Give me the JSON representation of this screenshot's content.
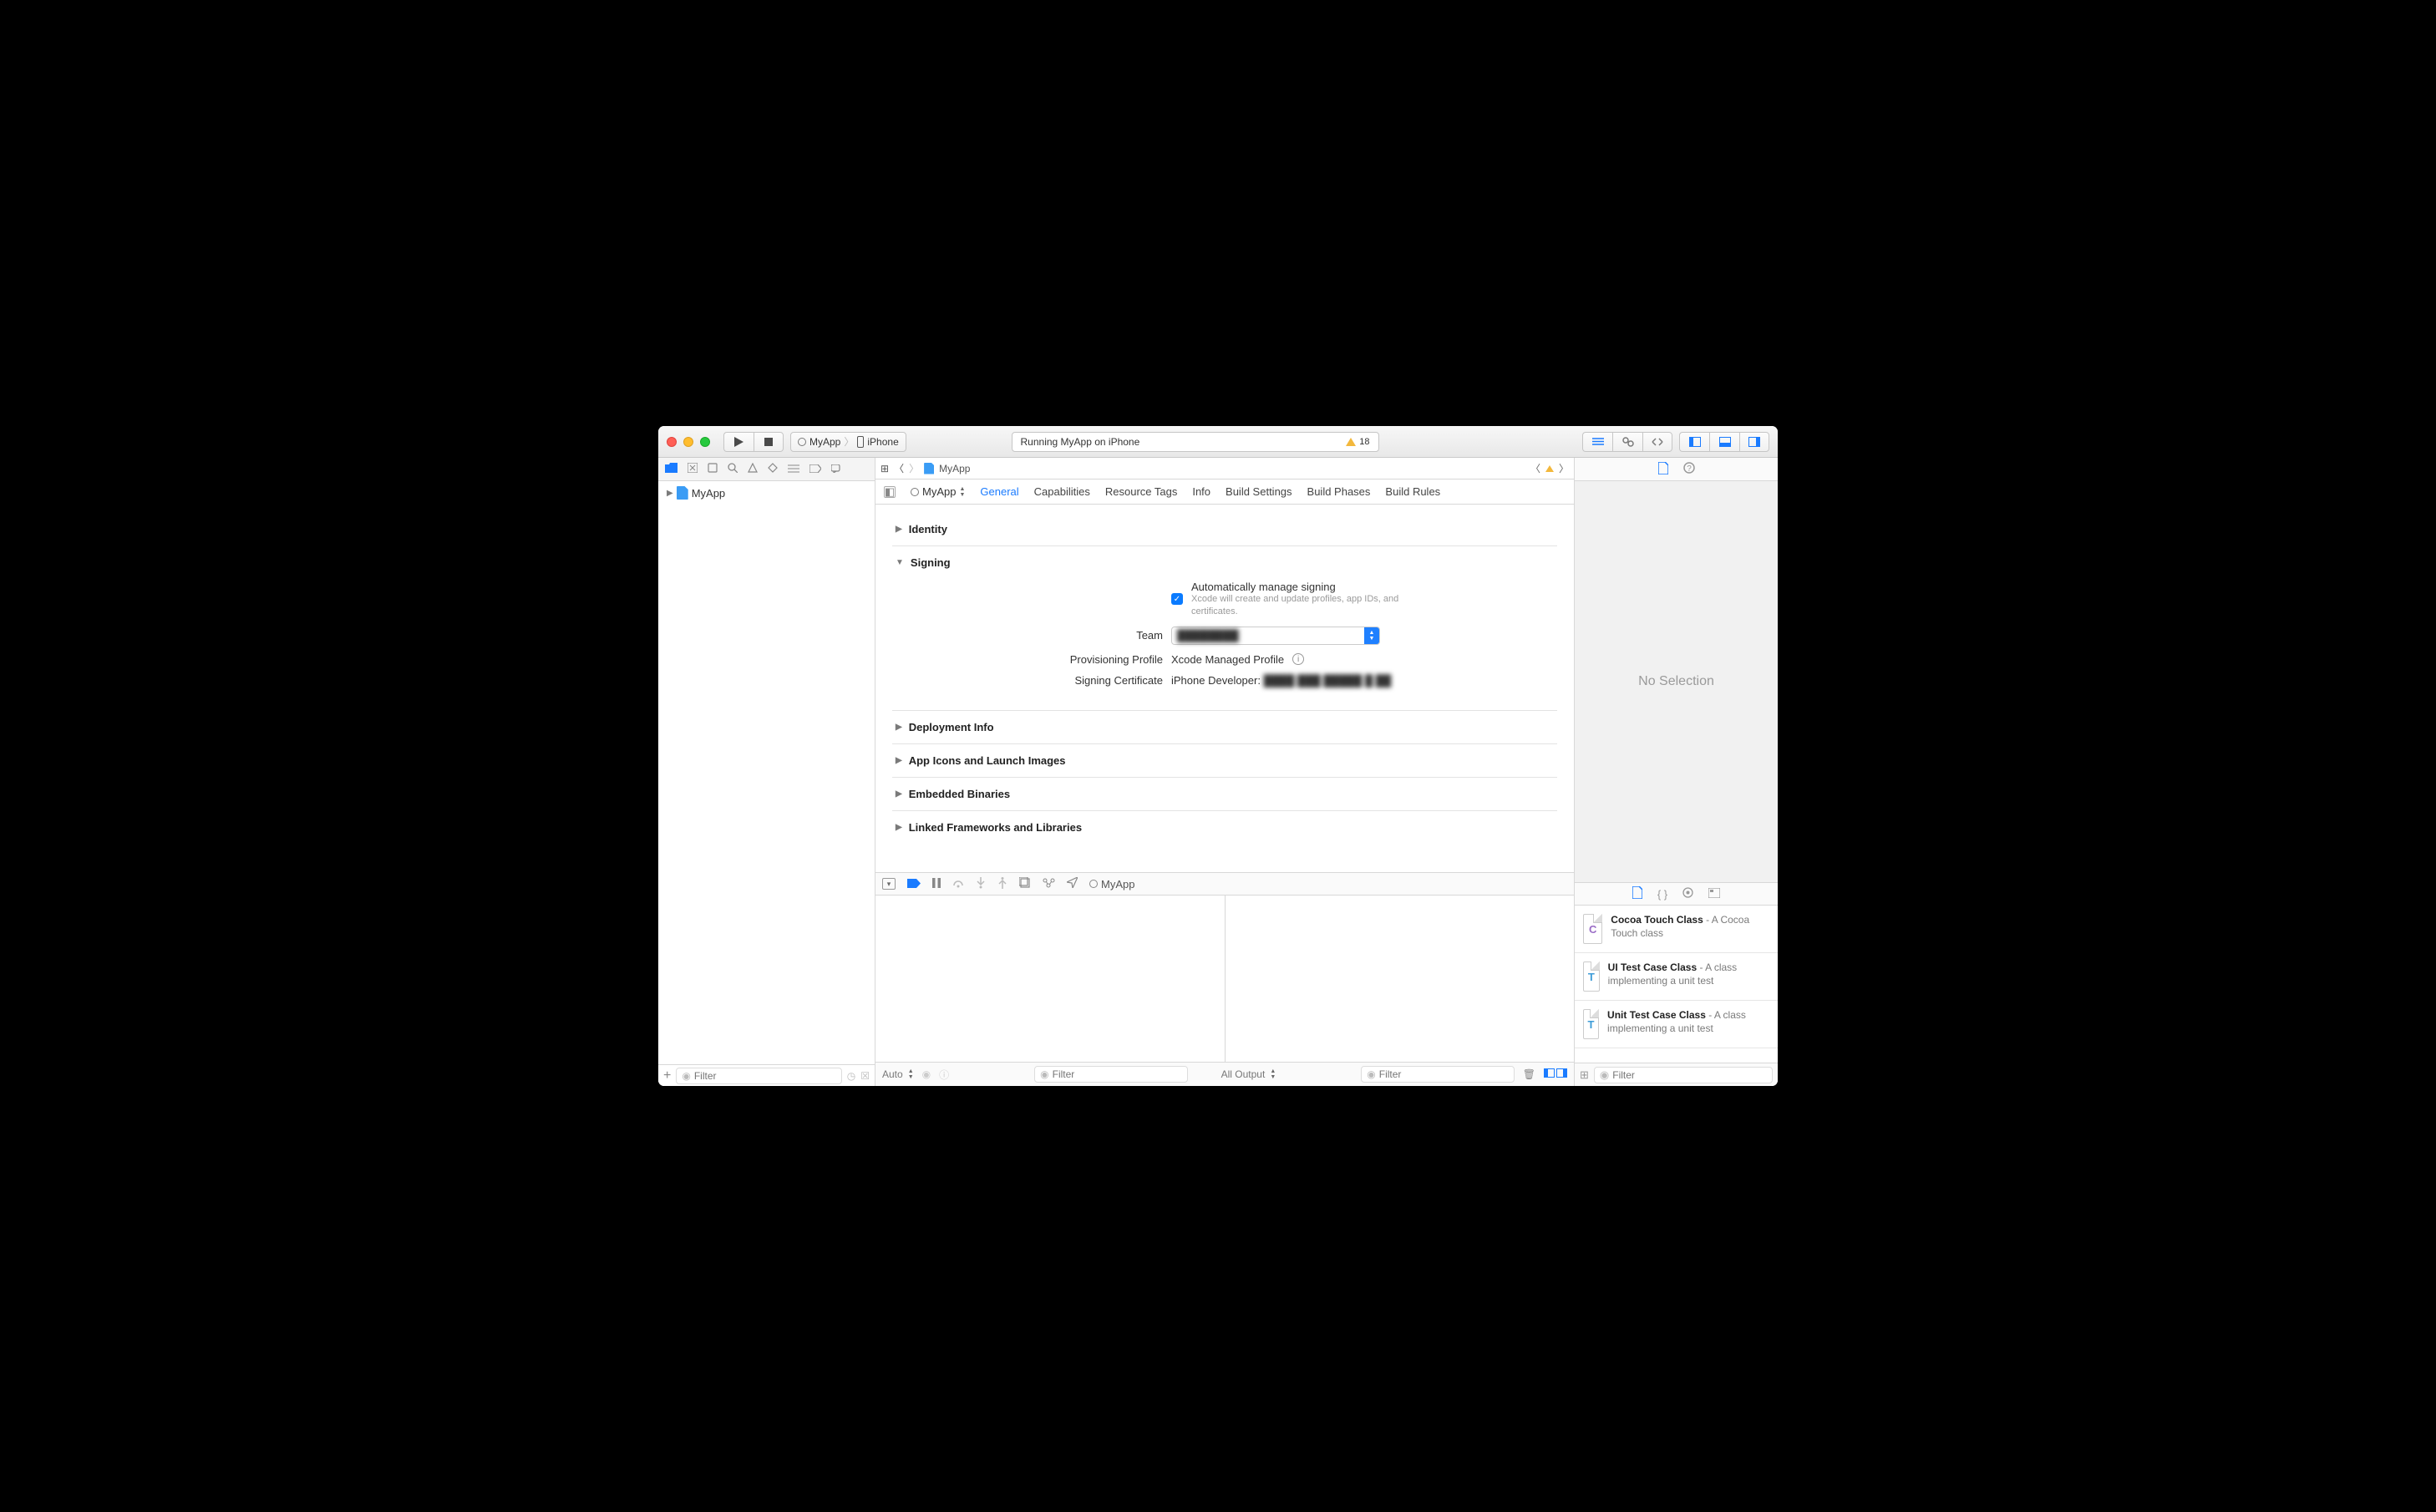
{
  "titlebar": {
    "scheme_target": "MyApp",
    "scheme_device": "iPhone",
    "status": "Running MyApp on iPhone",
    "warning_count": "18"
  },
  "navigator": {
    "root": "MyApp",
    "filter_placeholder": "Filter"
  },
  "jumpbar": {
    "item": "MyApp"
  },
  "target_selector": "MyApp",
  "tabs": [
    "General",
    "Capabilities",
    "Resource Tags",
    "Info",
    "Build Settings",
    "Build Phases",
    "Build Rules"
  ],
  "active_tab_index": 0,
  "sections": {
    "identity": "Identity",
    "signing": "Signing",
    "deployment": "Deployment Info",
    "appicons": "App Icons and Launch Images",
    "embedded": "Embedded Binaries",
    "linked": "Linked Frameworks and Libraries"
  },
  "signing": {
    "auto_label": "Automatically manage signing",
    "auto_help": "Xcode will create and update profiles, app IDs, and certificates.",
    "team_label": "Team",
    "team_value": "████████",
    "profile_label": "Provisioning Profile",
    "profile_value": "Xcode Managed Profile",
    "cert_label": "Signing Certificate",
    "cert_prefix": "iPhone Developer:",
    "cert_value": "████ ███ █████ █ ██"
  },
  "debug": {
    "process": "MyApp",
    "auto": "Auto",
    "output": "All Output",
    "filter_placeholder": "Filter"
  },
  "inspector": {
    "empty": "No Selection",
    "library": [
      {
        "glyph": "C",
        "cls": "c",
        "title": "Cocoa Touch Class",
        "desc": " - A Cocoa Touch class"
      },
      {
        "glyph": "T",
        "cls": "t",
        "title": "UI Test Case Class",
        "desc": " - A class implementing a unit test"
      },
      {
        "glyph": "T",
        "cls": "t",
        "title": "Unit Test Case Class",
        "desc": " - A class implementing a unit test"
      }
    ],
    "filter_placeholder": "Filter"
  }
}
